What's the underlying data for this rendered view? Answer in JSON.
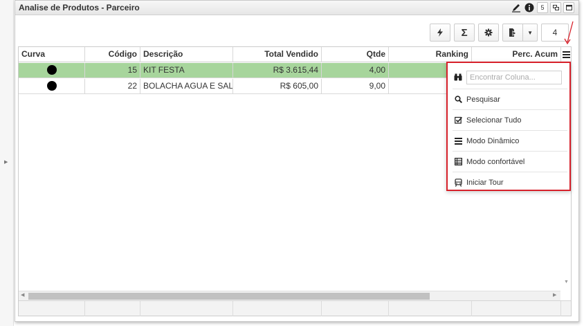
{
  "panel": {
    "title": "Analise de Produtos - Parceiro"
  },
  "header_icons": [
    "pencil-icon",
    "info-icon",
    "five-icon",
    "layout-icon",
    "window-icon"
  ],
  "header_labels": {
    "five": "5"
  },
  "toolbar": {
    "page": "4"
  },
  "columns": [
    {
      "label": "Curva"
    },
    {
      "label": "Código"
    },
    {
      "label": "Descrição"
    },
    {
      "label": "Total Vendido"
    },
    {
      "label": "Qtde"
    },
    {
      "label": "Ranking"
    },
    {
      "label": "Perc. Acum"
    }
  ],
  "rows": [
    {
      "curva": "●",
      "codigo": "15",
      "descricao": "KIT FESTA",
      "total": "R$ 3.615,44",
      "qtde": "4,00",
      "selected": true
    },
    {
      "curva": "●",
      "codigo": "22",
      "descricao": "BOLACHA AGUA E SAL",
      "total": "R$ 605,00",
      "qtde": "9,00",
      "selected": false
    }
  ],
  "menu": {
    "search_placeholder": "Encontrar Coluna...",
    "items": [
      {
        "label": "Pesquisar",
        "icon": "search-icon"
      },
      {
        "label": "Selecionar Tudo",
        "icon": "check-square-icon"
      },
      {
        "label": "Modo Dinâmico",
        "icon": "list-icon"
      },
      {
        "label": "Modo confortável",
        "icon": "table-icon"
      },
      {
        "label": "Iniciar Tour",
        "icon": "bus-icon"
      }
    ]
  },
  "colors": {
    "selected_row": "#a7d59c",
    "highlight_border": "#d7202a"
  }
}
